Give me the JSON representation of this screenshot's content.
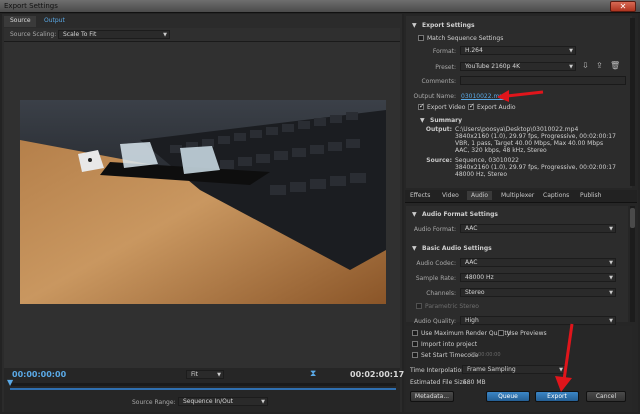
{
  "window": {
    "title": "Export Settings",
    "close_glyph": "✕"
  },
  "left": {
    "tabs": [
      {
        "label": "Source"
      },
      {
        "label": "Output"
      }
    ],
    "source_scaling_label": "Source Scaling:",
    "source_scaling_value": "Scale To Fit",
    "timecode_start": "00:00:00:00",
    "timecode_end": "00:02:00:17",
    "fit_value": "Fit",
    "source_range_label": "Source Range:",
    "source_range_value": "Sequence In/Out"
  },
  "export_settings": {
    "header": "Export Settings",
    "match_sequence_label": "Match Sequence Settings",
    "format_label": "Format:",
    "format_value": "H.264",
    "preset_label": "Preset:",
    "preset_value": "YouTube 2160p 4K",
    "comments_label": "Comments:",
    "output_name_label": "Output Name:",
    "output_name_value": "03010022.mp4",
    "export_video_label": "Export Video",
    "export_audio_label": "Export Audio"
  },
  "summary": {
    "header": "Summary",
    "output_label": "Output:",
    "output_lines": [
      "C:\\Users\\poosya\\Desktop\\03010022.mp4",
      "3840x2160 (1.0), 29.97 fps, Progressive, 00:02:00:17",
      "VBR, 1 pass, Target 40.00 Mbps, Max 40.00 Mbps",
      "AAC, 320 kbps, 48 kHz, Stereo"
    ],
    "source_label": "Source:",
    "source_lines": [
      "Sequence, 03010022",
      "3840x2160 (1.0), 29.97 fps, Progressive, 00:02:00:17",
      "48000 Hz, Stereo"
    ]
  },
  "right_tabs": [
    {
      "label": "Effects"
    },
    {
      "label": "Video"
    },
    {
      "label": "Audio"
    },
    {
      "label": "Multiplexer"
    },
    {
      "label": "Captions"
    },
    {
      "label": "Publish"
    }
  ],
  "audio": {
    "format_header": "Audio Format Settings",
    "audio_format_label": "Audio Format:",
    "audio_format_value": "AAC",
    "basic_header": "Basic Audio Settings",
    "codec_label": "Audio Codec:",
    "codec_value": "AAC",
    "sample_rate_label": "Sample Rate:",
    "sample_rate_value": "48000 Hz",
    "channels_label": "Channels:",
    "channels_value": "Stereo",
    "parametric_stereo_label": "Parametric Stereo",
    "quality_label": "Audio Quality:",
    "quality_value": "High"
  },
  "bottom": {
    "max_render_label": "Use Maximum Render Quality",
    "use_previews_label": "Use Previews",
    "import_project_label": "Import into project",
    "set_start_tc_label": "Set Start Timecode",
    "start_tc_value": "00:00:00:00",
    "time_interp_label": "Time Interpolation:",
    "time_interp_value": "Frame Sampling",
    "file_size_label": "Estimated File Size:",
    "file_size_value": "580 MB",
    "metadata_button": "Metadata...",
    "queue_button": "Queue",
    "export_button": "Export",
    "cancel_button": "Cancel"
  },
  "colors": {
    "accent": "#5aa9e6",
    "arrow": "#e0151b",
    "export_button": "#2f77b6"
  }
}
